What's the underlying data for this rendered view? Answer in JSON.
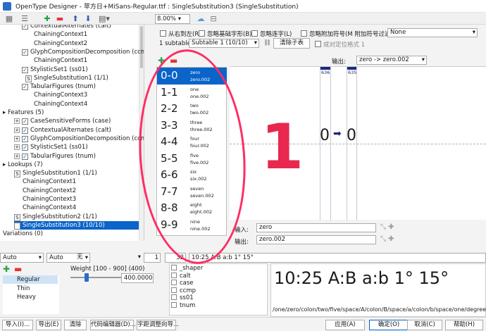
{
  "window": {
    "title": "OpenType Designer - 苹方日+MiSans-Regular.ttf : SingleSubstitution3 (SingleSubstitution)"
  },
  "toolbar": {
    "zoom": "8.00%"
  },
  "tree": {
    "rows": [
      {
        "label": "ContextualAlternates (calt)",
        "icon": "check",
        "indent": 1
      },
      {
        "label": "ChainingContext1",
        "icon": "none",
        "indent": 2
      },
      {
        "label": "ChainingContext2",
        "icon": "none",
        "indent": 2
      },
      {
        "label": "GlyphCompositionDecomposition (ccmp",
        "icon": "check",
        "indent": 1
      },
      {
        "label": "ChainingContext1",
        "icon": "none",
        "indent": 2
      },
      {
        "label": "StylisticSet1 (ss01)",
        "icon": "check",
        "indent": 1
      },
      {
        "label": "SingleSubstitution1 (1/1)",
        "icon": "s",
        "indent": 2
      },
      {
        "label": "TabularFigures (tnum)",
        "icon": "check",
        "indent": 1
      },
      {
        "label": "ChainingContext3",
        "icon": "none",
        "indent": 2
      },
      {
        "label": "ChainingContext4",
        "icon": "none",
        "indent": 2
      },
      {
        "label": "Features (5)",
        "icon": "group",
        "indent": 0
      },
      {
        "label": "CaseSensitiveForms (case)",
        "icon": "check",
        "indent": 1
      },
      {
        "label": "ContextualAlternates (calt)",
        "icon": "check",
        "indent": 1
      },
      {
        "label": "GlyphCompositionDecomposition (ccmp)",
        "icon": "check",
        "indent": 1
      },
      {
        "label": "StylisticSet1 (ss01)",
        "icon": "check",
        "indent": 1
      },
      {
        "label": "TabularFigures (tnum)",
        "icon": "check",
        "indent": 1
      },
      {
        "label": "Lookups (7)",
        "icon": "group",
        "indent": 0
      },
      {
        "label": "SingleSubstitution1 (1/1)",
        "icon": "s",
        "indent": 1
      },
      {
        "label": "ChainingContext1",
        "icon": "none",
        "indent": 1
      },
      {
        "label": "ChainingContext2",
        "icon": "none",
        "indent": 1
      },
      {
        "label": "ChainingContext3",
        "icon": "none",
        "indent": 1
      },
      {
        "label": "ChainingContext4",
        "icon": "none",
        "indent": 1
      },
      {
        "label": "SingleSubstitution2 (1/1)",
        "icon": "s",
        "indent": 1
      },
      {
        "label": "SingleSubstitution3 (10/10)",
        "icon": "s",
        "indent": 1,
        "selected": true
      },
      {
        "label": "Variations (0)",
        "icon": "leaf",
        "indent": 0
      }
    ]
  },
  "options": {
    "rtl": "从右到左(R)",
    "ignore_base": "忽略基础字形(B)",
    "ignore_lig": "忽略连字(L)",
    "ignore_mark": "忽略附加符号(M 附加符号过滤集",
    "filter_value": "None",
    "subtable_count": "1 subtable",
    "subtable_select": "Subtable 1 (10/10)",
    "clear_subtable": "清除子表",
    "anchor": "成对定位格式 1"
  },
  "output_header": {
    "label": "输出:",
    "value": "zero -> zero.002"
  },
  "list": {
    "items": [
      {
        "big": "0-0",
        "from": "zero",
        "to": "zero.002"
      },
      {
        "big": "1-1",
        "from": "one",
        "to": "one.002"
      },
      {
        "big": "2-2",
        "from": "two",
        "to": "two.002"
      },
      {
        "big": "3-3",
        "from": "three",
        "to": "three.002"
      },
      {
        "big": "4-4",
        "from": "four",
        "to": "four.002"
      },
      {
        "big": "5-5",
        "from": "five",
        "to": "five.002"
      },
      {
        "big": "6-6",
        "from": "six",
        "to": "six.002"
      },
      {
        "big": "7-7",
        "from": "seven",
        "to": "seven.002"
      },
      {
        "big": "8-8",
        "from": "eight",
        "to": "eight.002"
      },
      {
        "big": "9-9",
        "from": "nine",
        "to": "nine.002"
      }
    ]
  },
  "canvas": {
    "glyph_left": "636",
    "glyph_right": "635",
    "big_glyph": "1",
    "in_glyph": "0",
    "out_glyph": "0"
  },
  "io": {
    "input_label": "输入:",
    "input_value": "zero",
    "output_label": "输出:",
    "output_value": "zero.002"
  },
  "bottom": {
    "script": "Auto",
    "lang": "Auto",
    "feature": "无",
    "count": "1",
    "size": "32",
    "sample": "10:25 A:B a:b 1° 15°",
    "weight_label": "Weight [100 - 900] (400)",
    "weight_value": "400.0000",
    "styles": [
      "Regular",
      "Thin",
      "Heavy"
    ],
    "features": [
      "_shaper",
      "calt",
      "case",
      "ccmp",
      "ss01",
      "tnum"
    ],
    "preview": "10:25 A:B a:b 1° 15°",
    "glyph_names": "/one/zero/colon/two/five/space/A/colon/B/space/a/colon/b/space/one/degree/sp"
  },
  "buttons": {
    "import": "导入(I)...",
    "export": "导出(E)",
    "clear": "清除",
    "code_editor": "代码编辑器(D)...",
    "kern_wizard": "字距调整向导...",
    "apply": "应用(A)",
    "ok": "确定(O)",
    "cancel": "取消(C)",
    "help": "帮助(H)"
  },
  "colors": {
    "accent": "#0a64c9",
    "annotation": "#ff2d63",
    "glyph_red": "#e8284f"
  }
}
